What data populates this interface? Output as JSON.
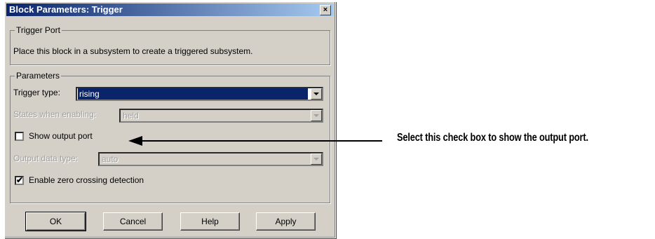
{
  "dialog": {
    "title": "Block Parameters: Trigger",
    "close_glyph": "×"
  },
  "trigger_port": {
    "legend": "Trigger Port",
    "description": "Place this block in a subsystem to create a triggered subsystem."
  },
  "parameters": {
    "legend": "Parameters",
    "trigger_type": {
      "label": "Trigger type:",
      "value": "rising"
    },
    "states_when_enabling": {
      "label": "States when enabling:",
      "value": "held"
    },
    "show_output_port": {
      "label": "Show output port",
      "checked": false
    },
    "output_data_type": {
      "label": "Output data type:",
      "value": "auto"
    },
    "enable_zero_crossing": {
      "label": "Enable zero crossing detection",
      "checked": true,
      "mark": "✔"
    }
  },
  "buttons": {
    "ok": "OK",
    "cancel": "Cancel",
    "help": "Help",
    "apply": "Apply"
  },
  "annotation": {
    "text": "Select this check box to show the output port."
  }
}
